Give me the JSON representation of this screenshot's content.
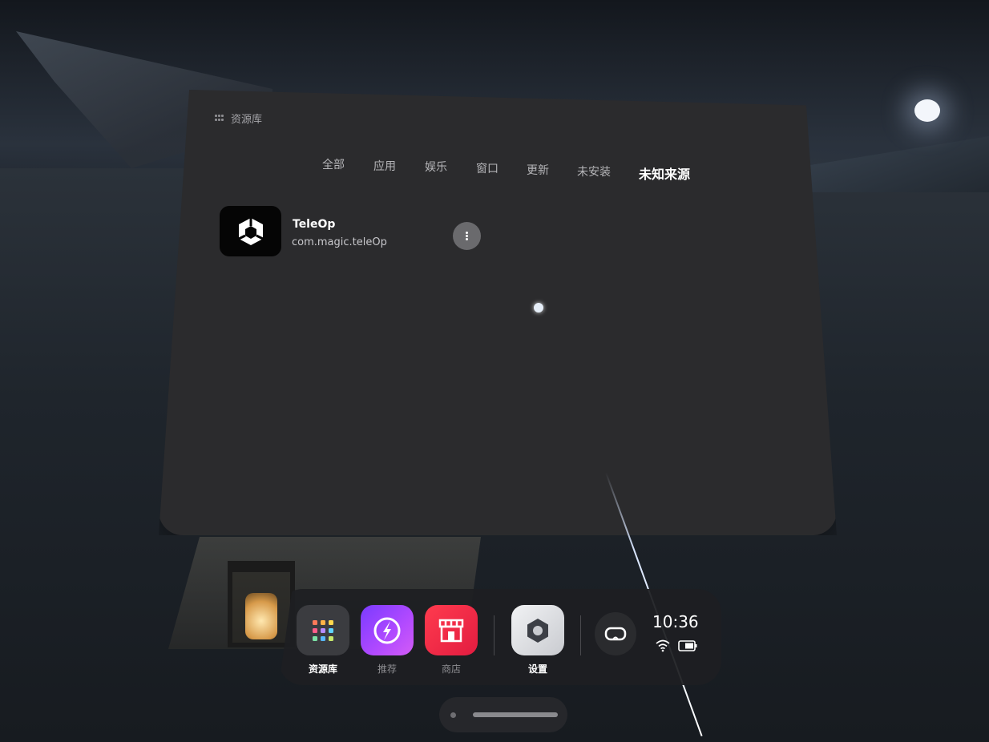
{
  "window": {
    "title": "资源库"
  },
  "tabs": [
    {
      "label": "全部"
    },
    {
      "label": "应用"
    },
    {
      "label": "娱乐"
    },
    {
      "label": "窗口"
    },
    {
      "label": "更新"
    },
    {
      "label": "未安装"
    },
    {
      "label": "未知来源",
      "active": true
    }
  ],
  "apps": [
    {
      "name": "TeleOp",
      "package": "com.magic.teleOp",
      "icon": "unity-cube-icon"
    }
  ],
  "dock": {
    "items": [
      {
        "label": "资源库",
        "icon": "app-grid-icon",
        "active": true
      },
      {
        "label": "推荐",
        "icon": "lightning-compass-icon"
      },
      {
        "label": "商店",
        "icon": "store-icon"
      },
      {
        "label": "设置",
        "icon": "hex-settings-icon"
      }
    ],
    "clock": "10:36",
    "status_icons": [
      "wifi-icon",
      "battery-icon",
      "vr-headset-icon"
    ]
  },
  "colors": {
    "panel": "#2b2b2d",
    "dock": "#1e1f22",
    "recommend_accent": "#8a3cff",
    "store_accent": "#f02a44"
  }
}
